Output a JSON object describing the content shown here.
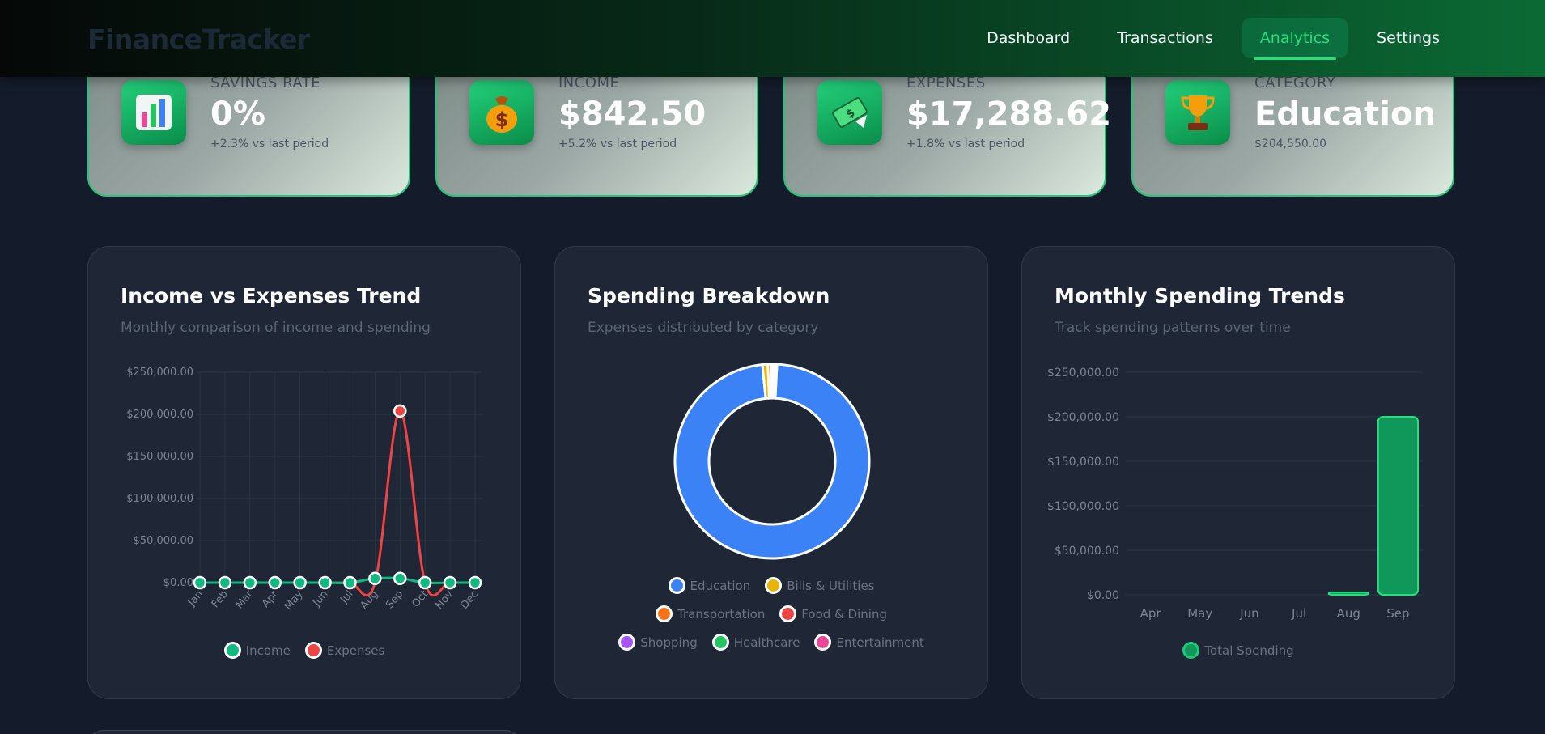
{
  "app": {
    "brand": "FinanceTracker"
  },
  "nav": [
    {
      "label": "Dashboard",
      "active": false
    },
    {
      "label": "Transactions",
      "active": false
    },
    {
      "label": "Analytics",
      "active": true
    },
    {
      "label": "Settings",
      "active": false
    }
  ],
  "stats": [
    {
      "icon": "bar-chart-icon",
      "label": "SAVINGS RATE",
      "value": "0%",
      "sub": "+2.3% vs last period"
    },
    {
      "icon": "money-bag-icon",
      "label": "INCOME",
      "value": "$842.50",
      "sub": "+5.2% vs last period"
    },
    {
      "icon": "money-flying-icon",
      "label": "EXPENSES",
      "value": "$17,288.62",
      "sub": "+1.8% vs last period"
    },
    {
      "icon": "trophy-icon",
      "label": "CATEGORY",
      "value": "Education",
      "sub": "$204,550.00"
    }
  ],
  "colors": {
    "accent": "#22e07a",
    "income": "#10b981",
    "expenses": "#ef4444",
    "education": "#3b82f6",
    "bills": "#eab308",
    "transportation": "#f97316",
    "food": "#ef4444",
    "shopping": "#a855f7",
    "healthcare": "#22c55e",
    "entertainment": "#ec4899",
    "bar": "#10985a"
  },
  "charts": {
    "trend": {
      "title": "Income vs Expenses Trend",
      "subtitle": "Monthly comparison of income and spending"
    },
    "breakdown": {
      "title": "Spending Breakdown",
      "subtitle": "Expenses distributed by category"
    },
    "monthly": {
      "title": "Monthly Spending Trends",
      "subtitle": "Track spending patterns over time"
    }
  },
  "chart_data": [
    {
      "type": "line",
      "title": "Income vs Expenses Trend",
      "subtitle": "Monthly comparison of income and spending",
      "categories": [
        "Jan",
        "Feb",
        "Mar",
        "Apr",
        "May",
        "Jun",
        "Jul",
        "Aug",
        "Sep",
        "Oct",
        "Nov",
        "Dec"
      ],
      "y_ticks": [
        "$0.00",
        "$50,000.00",
        "$100,000.00",
        "$150,000.00",
        "$200,000.00",
        "$250,000.00"
      ],
      "ylim": [
        0,
        250000
      ],
      "series": [
        {
          "name": "Income",
          "values": [
            0,
            0,
            0,
            0,
            0,
            0,
            0,
            5000,
            5000,
            0,
            0,
            0
          ]
        },
        {
          "name": "Expenses",
          "values": [
            0,
            0,
            0,
            0,
            0,
            0,
            0,
            0,
            204000,
            0,
            0,
            0
          ]
        }
      ],
      "grid": true,
      "legend": "bottom"
    },
    {
      "type": "pie",
      "title": "Spending Breakdown",
      "subtitle": "Expenses distributed by category",
      "categories": [
        "Education",
        "Bills & Utilities",
        "Transportation",
        "Food & Dining",
        "Shopping",
        "Healthcare",
        "Entertainment"
      ],
      "values": [
        97.6,
        0.9,
        0.6,
        0.4,
        0.2,
        0.2,
        0.1
      ],
      "donut": true,
      "legend": "bottom"
    },
    {
      "type": "bar",
      "title": "Monthly Spending Trends",
      "subtitle": "Track spending patterns over time",
      "categories": [
        "Apr",
        "May",
        "Jun",
        "Jul",
        "Aug",
        "Sep"
      ],
      "values": [
        0,
        0,
        0,
        0,
        2000,
        200000
      ],
      "y_ticks": [
        "$0.00",
        "$50,000.00",
        "$100,000.00",
        "$150,000.00",
        "$200,000.00",
        "$250,000.00"
      ],
      "ylim": [
        0,
        250000
      ],
      "series_name": "Total Spending",
      "grid": true,
      "legend": "bottom"
    }
  ]
}
